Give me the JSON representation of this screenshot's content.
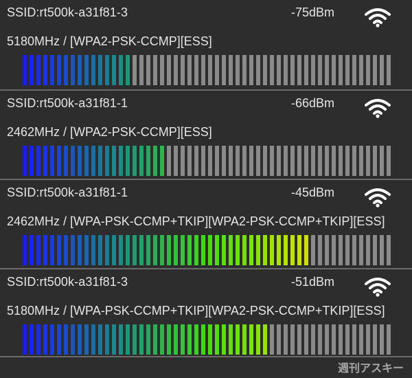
{
  "networks": [
    {
      "ssid": "SSID:rt500k-a31f81-3",
      "dbm": "-75dBm",
      "freq": "5180MHz / [WPA2-PSK-CCMP][ESS]",
      "signal_fraction": 0.29
    },
    {
      "ssid": "SSID:rt500k-a31f81-1",
      "dbm": "-66dBm",
      "freq": "2462MHz / [WPA2-PSK-CCMP][ESS]",
      "signal_fraction": 0.39
    },
    {
      "ssid": "SSID:rt500k-a31f81-1",
      "dbm": "-45dBm",
      "freq": "2462MHz / [WPA-PSK-CCMP+TKIP][WPA2-PSK-CCMP+TKIP][ESS]",
      "signal_fraction": 0.78
    },
    {
      "ssid": "SSID:rt500k-a31f81-3",
      "dbm": "-51dBm",
      "freq": "5180MHz / [WPA-PSK-CCMP+TKIP][WPA2-PSK-CCMP+TKIP][ESS]",
      "signal_fraction": 0.67
    }
  ],
  "watermark": "週刊アスキー",
  "icon": "wifi-icon",
  "colors": {
    "background": "#2d2d2d",
    "inactive_bar": "#8a8a8a",
    "gradient": [
      "#1a1aff",
      "#1a8a8a",
      "#3fdc16",
      "#c8e400",
      "#ff9900"
    ]
  }
}
